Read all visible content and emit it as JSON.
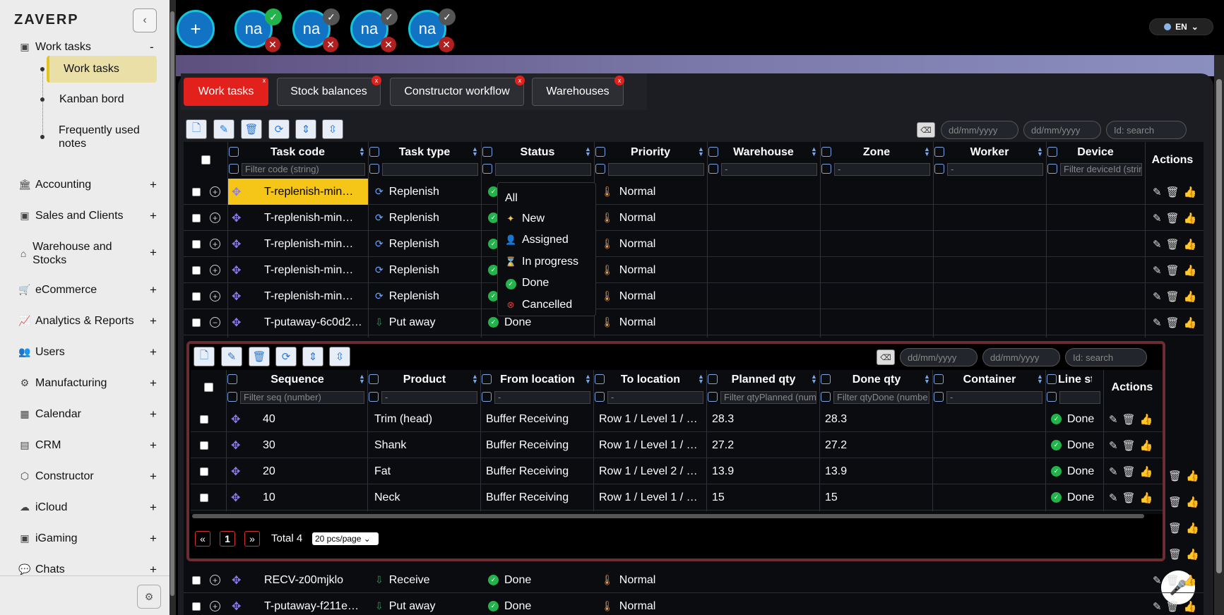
{
  "app": {
    "logo": "ZAVERP",
    "lang": "EN"
  },
  "sidebar": {
    "work_tasks": "Work tasks",
    "sub": [
      "Work tasks",
      "Kanban bord",
      "Frequently used notes"
    ],
    "items": [
      "Accounting",
      "Sales and Clients",
      "Warehouse and Stocks",
      "eCommerce",
      "Analytics & Reports",
      "Users",
      "Manufacturing",
      "Calendar",
      "CRM",
      "Constructor",
      "iCloud",
      "iGaming",
      "Chats"
    ],
    "collapse_minus": "-",
    "plus": "+"
  },
  "avatars": [
    "na",
    "na",
    "na",
    "na"
  ],
  "add_label": "+",
  "tabs": [
    "Work tasks",
    "Stock balances",
    "Constructor workflow",
    "Warehouses"
  ],
  "tab_close": "x",
  "date_placeholder": "dd/mm/yyyy",
  "search_placeholder": "Id: search",
  "main_table": {
    "headers": [
      "Task code",
      "Task type",
      "Status",
      "Priority",
      "Warehouse",
      "Zone",
      "Worker",
      "Device",
      "Actions"
    ],
    "filters": [
      "Filter code (string)",
      "",
      "",
      "",
      "-",
      "-",
      "-",
      "Filter deviceId (strin"
    ],
    "rows": [
      {
        "code": "T-replenish-min…",
        "type": "Replenish",
        "status": "",
        "priority": "Normal"
      },
      {
        "code": "T-replenish-min…",
        "type": "Replenish",
        "status": "",
        "priority": "Normal"
      },
      {
        "code": "T-replenish-min…",
        "type": "Replenish",
        "status": "",
        "priority": "Normal"
      },
      {
        "code": "T-replenish-min…",
        "type": "Replenish",
        "status": "",
        "priority": "Normal"
      },
      {
        "code": "T-replenish-min…",
        "type": "Replenish",
        "status": "",
        "priority": "Normal"
      },
      {
        "code": "T-putaway-6c0d2…",
        "type": "Put away",
        "status": "Done",
        "priority": "Normal"
      }
    ],
    "bottom_rows": [
      {
        "code": "RECV-z00mjklo",
        "type": "Receive",
        "status": "Done",
        "priority": "Normal"
      },
      {
        "code": "T-putaway-f211e…",
        "type": "Put away",
        "status": "Done",
        "priority": "Normal"
      }
    ]
  },
  "status_dropdown": {
    "options": [
      "All",
      "New",
      "Assigned",
      "In progress",
      "Done",
      "Cancelled"
    ]
  },
  "sub_table": {
    "headers": [
      "Sequence",
      "Product",
      "From location",
      "To location",
      "Planned qty",
      "Done qty",
      "Container",
      "Line status",
      "Actions"
    ],
    "filters": [
      "Filter seq (number)",
      "-",
      "-",
      "-",
      "Filter qtyPlanned (num",
      "Filter qtyDone (numbe",
      "-",
      ""
    ],
    "rows": [
      {
        "seq": "40",
        "product": "Trim (head)",
        "from": "Buffer Receiving",
        "to": "Row 1 / Level 1 / …",
        "planned": "28.3",
        "done": "28.3",
        "status": "Done"
      },
      {
        "seq": "30",
        "product": "Shank",
        "from": "Buffer Receiving",
        "to": "Row 1 / Level 1 / …",
        "planned": "27.2",
        "done": "27.2",
        "status": "Done"
      },
      {
        "seq": "20",
        "product": "Fat",
        "from": "Buffer Receiving",
        "to": "Row 1 / Level 2 / …",
        "planned": "13.9",
        "done": "13.9",
        "status": "Done"
      },
      {
        "seq": "10",
        "product": "Neck",
        "from": "Buffer Receiving",
        "to": "Row 1 / Level 1 / …",
        "planned": "15",
        "done": "15",
        "status": "Done"
      }
    ],
    "pagination": {
      "prev": "«",
      "page": "1",
      "next": "»",
      "total": "Total 4",
      "per_page": "20 pcs/page"
    }
  }
}
